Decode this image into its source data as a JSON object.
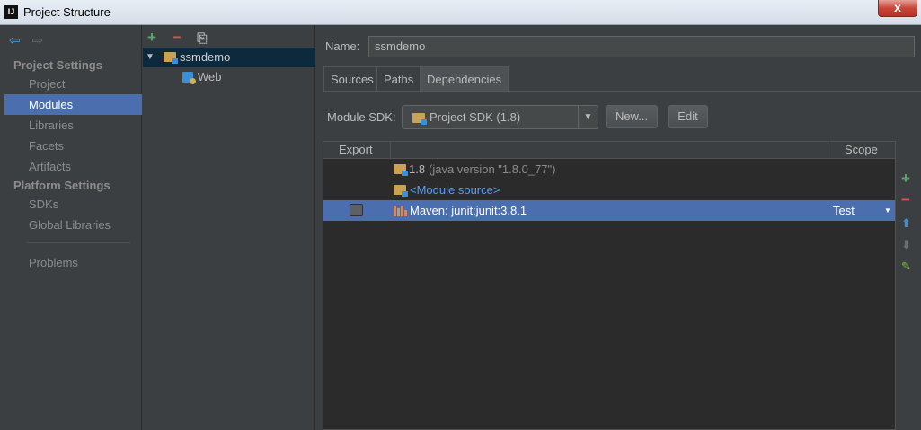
{
  "window": {
    "title": "Project Structure",
    "app_icon_text": "IJ",
    "close_label": "x"
  },
  "nav": {
    "back_icon": "arrow-left-icon",
    "forward_icon": "arrow-right-icon",
    "section_project": "Project Settings",
    "section_platform": "Platform Settings",
    "items": [
      {
        "label": "Project",
        "selected": false
      },
      {
        "label": "Modules",
        "selected": true
      },
      {
        "label": "Libraries",
        "selected": false
      },
      {
        "label": "Facets",
        "selected": false
      },
      {
        "label": "Artifacts",
        "selected": false
      }
    ],
    "platform_items": [
      {
        "label": "SDKs"
      },
      {
        "label": "Global Libraries"
      }
    ],
    "problems": "Problems"
  },
  "modules": {
    "tree": [
      {
        "label": "ssmdemo",
        "expanded": true,
        "selected": true
      },
      {
        "label": "Web"
      }
    ]
  },
  "main": {
    "name_label": "Name:",
    "name_value": "ssmdemo",
    "tabs": [
      {
        "label": "Sources",
        "active": false
      },
      {
        "label": "Paths",
        "active": false
      },
      {
        "label": "Dependencies",
        "active": true
      }
    ],
    "sdk_label": "Module SDK:",
    "sdk_value": "Project SDK (1.8)",
    "new_button": "New...",
    "edit_button": "Edit",
    "table": {
      "headers": {
        "export": "Export",
        "scope": "Scope"
      },
      "rows": [
        {
          "name": "1.8",
          "detail": "(java version \"1.8.0_77\")",
          "scope": "",
          "selected": false
        },
        {
          "name": "<Module source>",
          "detail": "",
          "scope": "",
          "selected": false
        },
        {
          "name": "Maven: junit:junit:3.8.1",
          "detail": "",
          "scope": "Test",
          "selected": true,
          "exported": false
        }
      ]
    }
  },
  "colors": {
    "selection": "#4b6eaf",
    "background": "#3c3f41",
    "table_bg": "#2b2b2b",
    "link": "#589df6"
  }
}
